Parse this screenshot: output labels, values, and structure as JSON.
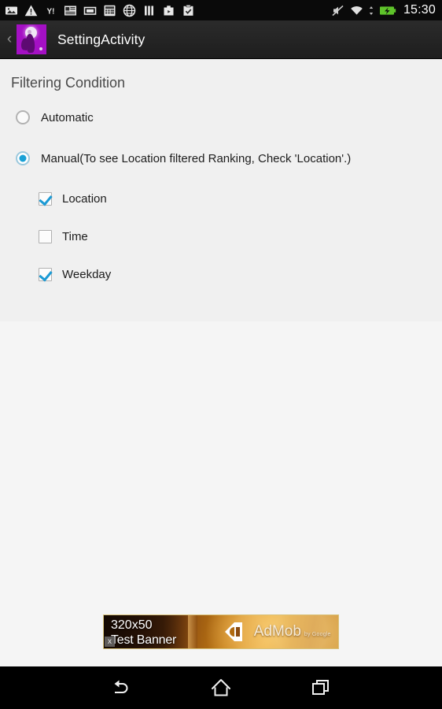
{
  "status_bar": {
    "notification_icons": [
      "image-icon",
      "warning-triangle-icon",
      "yahoo-icon",
      "news-list-icon",
      "card-icon",
      "calculator-icon",
      "globe-icon",
      "columns-icon",
      "briefcase-icon",
      "clipboard-check-icon"
    ],
    "right_icons": [
      "mute-icon",
      "wifi-icon",
      "battery-charging-icon"
    ],
    "time": "15:30",
    "background_color": "#0a0a0a",
    "battery_color": "#5ec32a"
  },
  "action_bar": {
    "back_icon": "back-chevron-icon",
    "back_glyph": "‹",
    "app_icon": "app-launcher-icon",
    "title": "SettingActivity",
    "background_color": "#232323",
    "app_icon_color": "#a410c4"
  },
  "settings": {
    "section_title": "Filtering Condition",
    "radio_group": [
      {
        "label": "Automatic",
        "checked": false
      },
      {
        "label": "Manual(To see Location filtered Ranking, Check 'Location'.)",
        "checked": true
      }
    ],
    "checkboxes": [
      {
        "label": "Location",
        "checked": true
      },
      {
        "label": "Time",
        "checked": false
      },
      {
        "label": "Weekday",
        "checked": true
      }
    ],
    "panel_color": "#f0f0f0",
    "accent_color": "#1aa1d6"
  },
  "ad": {
    "line1": "320x50",
    "line2": "Test Banner",
    "brand": "AdMob",
    "brand_suffix": "by Google",
    "close_label": "x",
    "size": "320x50"
  },
  "nav_bar": {
    "buttons": [
      {
        "name": "back-button",
        "icon": "back-arrow-icon"
      },
      {
        "name": "home-button",
        "icon": "home-icon"
      },
      {
        "name": "recents-button",
        "icon": "recent-apps-icon"
      }
    ],
    "background_color": "#000000"
  }
}
